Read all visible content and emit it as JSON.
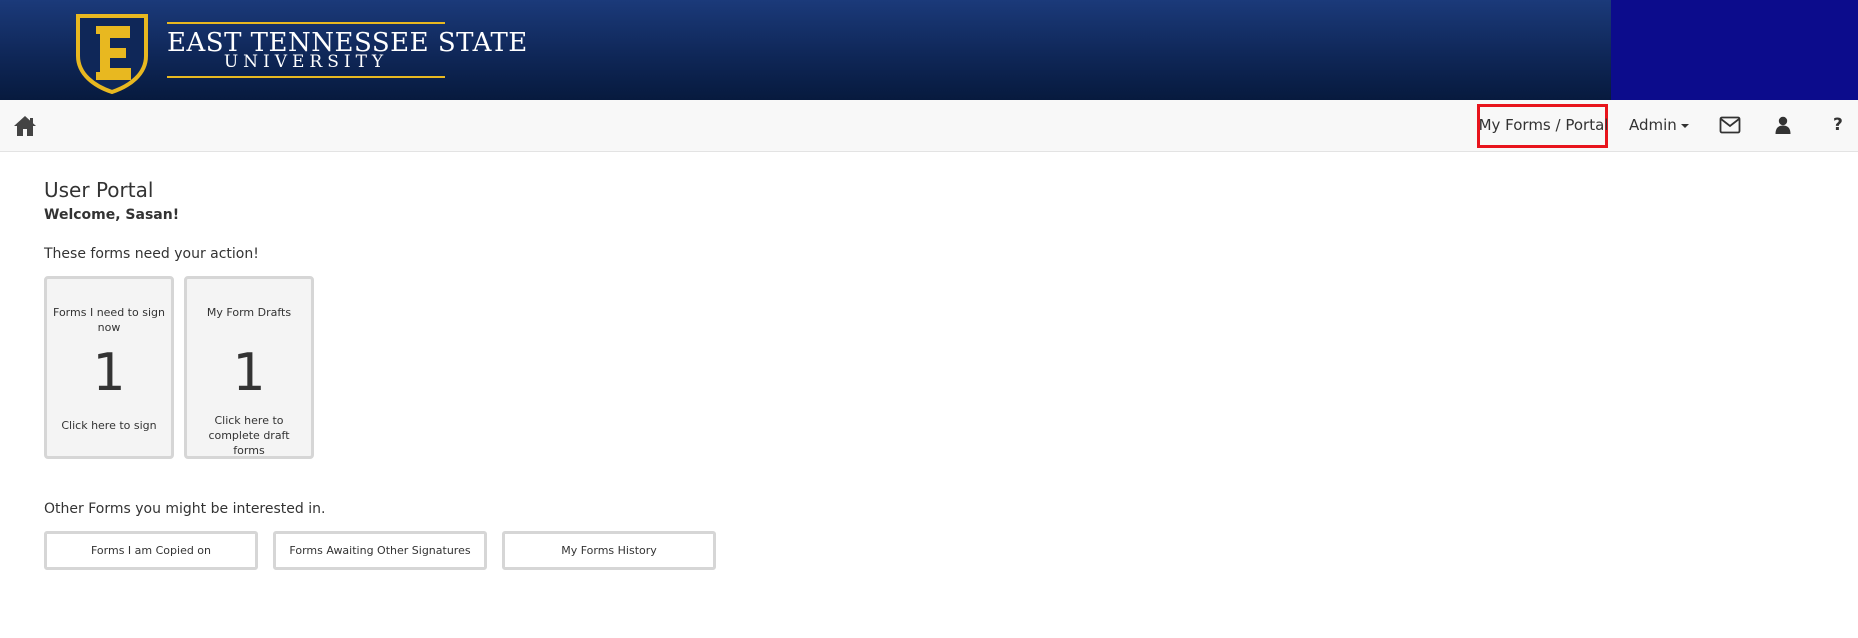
{
  "header": {
    "logo_line1": "EAST TENNESSEE STATE",
    "logo_line2": "UNIVERSITY",
    "logo_letter": "E",
    "colors": {
      "banner": "#0f2758",
      "banner_right": "#0c0c8c",
      "gold": "#e8b820"
    }
  },
  "navbar": {
    "home_icon": "home-icon",
    "my_forms_label": "My Forms / Portal",
    "admin_label": "Admin",
    "mail_icon": "envelope-icon",
    "user_icon": "user-icon",
    "help_label": "?",
    "highlight_color": "#e8141c"
  },
  "main": {
    "title": "User Portal",
    "welcome": "Welcome, Sasan!",
    "need_action_text": "These forms need your action!",
    "tiles": [
      {
        "title": "Forms I need to sign now",
        "count": "1",
        "link": "Click here to sign"
      },
      {
        "title": "My Form Drafts",
        "count": "1",
        "link": "Click here to complete draft forms"
      }
    ],
    "other_forms_text": "Other Forms you might be interested in.",
    "other_buttons": [
      {
        "label": "Forms I am Copied on"
      },
      {
        "label": "Forms Awaiting Other Signatures"
      },
      {
        "label": "My Forms History"
      }
    ]
  }
}
